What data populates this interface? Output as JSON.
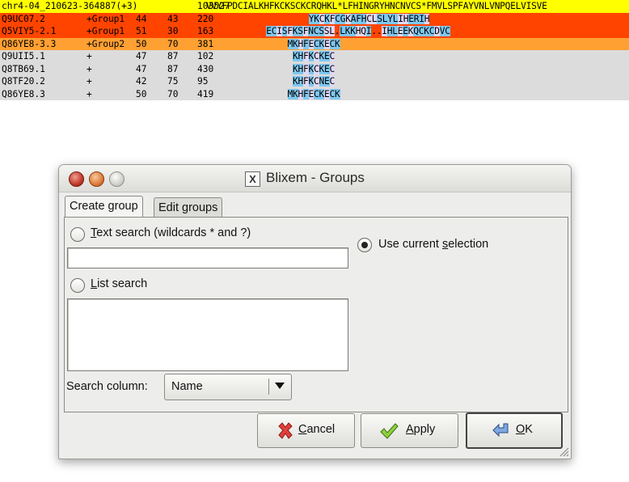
{
  "alignment": {
    "rows": [
      {
        "name": "chr4-04_210623-364887(+3)",
        "group": "",
        "score": "",
        "id": "",
        "start": "103527",
        "seq": "VVYFPDCIALKHFKCKSCKCRQHKL*LFHINGRYHNCNVCS*FMVLSPFAYVNLVNPQELVISVE",
        "bg": "#ffff00"
      },
      {
        "name": "Q9UC07.2",
        "group": "+Group1",
        "score": "44",
        "id": "43",
        "start": "220",
        "seq": "YKCKFCGKAFHCLSLYLIHERIH",
        "bg": "#ff4400"
      },
      {
        "name": "Q5VIY5-2.1",
        "group": "+Group1",
        "score": "51",
        "id": "30",
        "start": "163",
        "seq": "ECISFKSFNCSSL.LKKHQI..IHLEEKQCKCDVC",
        "bg": "#ff4400"
      },
      {
        "name": "Q86YE8-3.3",
        "group": "+Group2",
        "score": "50",
        "id": "70",
        "start": "381",
        "seq": "MKHFECKECK",
        "bg": "#ffa033"
      },
      {
        "name": "Q9UII5.1",
        "group": "+",
        "score": "47",
        "id": "87",
        "start": "102",
        "seq": "KHFKCKEC",
        "bg": "#dcdcdc"
      },
      {
        "name": "Q8TB69.1",
        "group": "+",
        "score": "47",
        "id": "87",
        "start": "430",
        "seq": "KHFKCKEC",
        "bg": "#dcdcdc"
      },
      {
        "name": "Q8TF20.2",
        "group": "+",
        "score": "42",
        "id": "75",
        "start": "95",
        "seq": "KHFKCNEC",
        "bg": "#dcdcdc"
      },
      {
        "name": "Q86YE8.3",
        "group": "+",
        "score": "50",
        "id": "70",
        "start": "419",
        "seq": "MKHFECKECK",
        "bg": "#dcdcdc"
      }
    ]
  },
  "dialog": {
    "title": "Blixem - Groups",
    "tabs": [
      {
        "label": "Create group"
      },
      {
        "label": "Edit groups"
      }
    ],
    "text_search": {
      "label_u": "T",
      "label_rest": "ext search (wildcards * and ?)",
      "value": ""
    },
    "list_search": {
      "label_u": "L",
      "label_rest": "ist search",
      "value": ""
    },
    "use_selection": {
      "label_pre": "Use current ",
      "label_u": "s",
      "label_rest": "election"
    },
    "search_column": {
      "label": "Search column:",
      "selected": "Name"
    },
    "buttons": {
      "cancel": {
        "u": "C",
        "rest": "ancel"
      },
      "apply": {
        "u": "A",
        "rest": "pply"
      },
      "ok": {
        "u": "O",
        "rest": "K"
      }
    }
  },
  "colors": {
    "selected_highlight": "#ffff00",
    "group1": "#ff4400",
    "group2": "#ffa033",
    "match": "#7ec8f0",
    "mismatch": "#e0d8f8"
  }
}
